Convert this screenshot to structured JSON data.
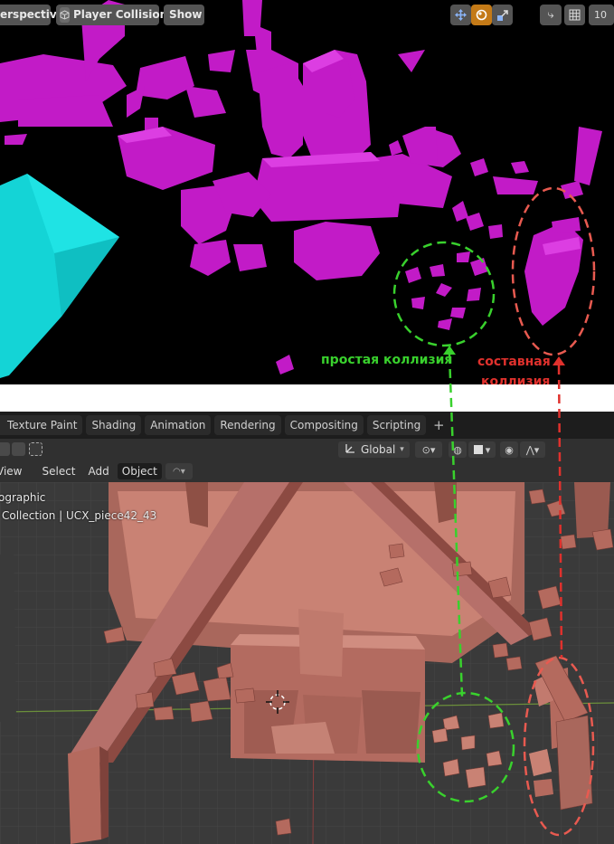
{
  "top_header": {
    "view_mode": "erspective",
    "collision_button": "Player Collision",
    "show_button": "Show",
    "zoom_value": "10"
  },
  "annotations": {
    "simple_collision": "простая коллизия",
    "compound_collision_line1": "составная",
    "compound_collision_line2": "коллизия"
  },
  "workspace_tabs": [
    "Texture Paint",
    "Shading",
    "Animation",
    "Rendering",
    "Compositing",
    "Scripting"
  ],
  "workspace_add": "+",
  "tool_header": {
    "orientation": "Global"
  },
  "viewport_menu": {
    "view": "View",
    "select": "Select",
    "add": "Add",
    "object": "Object"
  },
  "viewport_overlay": {
    "view_name": "ographic",
    "collection_path": "Collection | UCX_piece42_43"
  },
  "colors": {
    "collision_magenta": "#c21bc7",
    "collision_cyan": "#14d4d6",
    "mesh_terracotta": "#b46a5e",
    "simple_annotation": "#39d12d",
    "compound_annotation": "#e0312d",
    "active_icon": "#c47a17"
  },
  "icons": [
    "move-gizmo-icon",
    "shading-sphere-icon",
    "scale-icon",
    "snap-icon",
    "grid-icon",
    "orientation-icon",
    "pivot-icon",
    "snap-magnet-icon",
    "proportional-icon",
    "falloff-icon",
    "3d-cursor-icon"
  ]
}
